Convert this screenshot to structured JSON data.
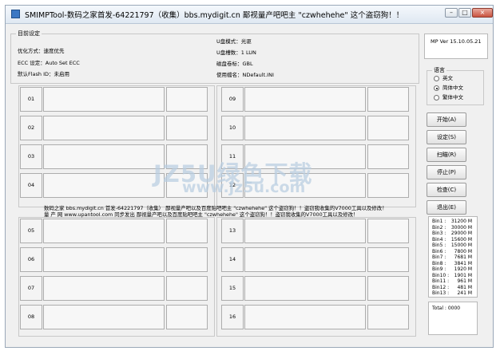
{
  "window": {
    "title": "SMIMPTool-数码之家首发-64221797（收集）bbs.mydigit.cn 鄙视量产吧吧主 \"czwhehehe\" 这个盗窃狗！！",
    "controls": {
      "minimize": "–",
      "maximize": "□",
      "close": "×"
    }
  },
  "settings": {
    "group_label": "目前设定",
    "left": [
      "优化方式：速度优先",
      "ECC 设定：Auto Set ECC",
      "默认Flash ID：未启用"
    ],
    "right": [
      "U盘模式：光驱",
      "U盘槽数：1 LUN",
      "磁盘卷标：GBL",
      "使用檔名：NDefault.INI"
    ]
  },
  "version": "MP Ver 15.10.05.21",
  "language": {
    "label": "语言",
    "options": [
      {
        "label": "英文",
        "selected": false
      },
      {
        "label": "简体中文",
        "selected": true
      },
      {
        "label": "繁体中文",
        "selected": false
      }
    ]
  },
  "buttons": {
    "start": "开始(A)",
    "settings": "设定(S)",
    "scan": "扫瞄(R)",
    "stop": "停止(P)",
    "check": "检查(C)",
    "exit": "退出(E)"
  },
  "slots": [
    "01",
    "02",
    "03",
    "04",
    "05",
    "06",
    "07",
    "08",
    "09",
    "10",
    "11",
    "12",
    "13",
    "14",
    "15",
    "16"
  ],
  "marquee": {
    "line1": "数码之家  bbs.mydigit.cn  首发-64221797（收集）  鄙视量产吧以及百度贴吧吧主 \"czwhehehe\" 这个盗窃狗！！盗窃我收集的V7000工具以及修改！",
    "line2": "量 产 网  www.upantool.com  同步发出      鄙视量产吧以及百度贴吧吧主 \"czwhehehe\" 这个盗窃狗！！盗窃我收集的V7000工具以及修改！"
  },
  "bins": [
    {
      "name": "Bin1 :",
      "value": "31200 M"
    },
    {
      "name": "Bin2 :",
      "value": "30000 M"
    },
    {
      "name": "Bin3 :",
      "value": "29000 M"
    },
    {
      "name": "Bin4 :",
      "value": "15600 M"
    },
    {
      "name": "Bin5 :",
      "value": "15000 M"
    },
    {
      "name": "Bin6 :",
      "value": "7800 M"
    },
    {
      "name": "Bin7 :",
      "value": "7681 M"
    },
    {
      "name": "Bin8 :",
      "value": "3841 M"
    },
    {
      "name": "Bin9 :",
      "value": "1920 M"
    },
    {
      "name": "Bin10 :",
      "value": "1901 M"
    },
    {
      "name": "Bin11 :",
      "value": "961 M"
    },
    {
      "name": "Bin12 :",
      "value": "481 M"
    },
    {
      "name": "Bin13 :",
      "value": "241 M"
    }
  ],
  "total": "Total : 0000",
  "watermark": {
    "line1": "JZ5U绿色下载",
    "line2": "www.jz5u.com"
  }
}
